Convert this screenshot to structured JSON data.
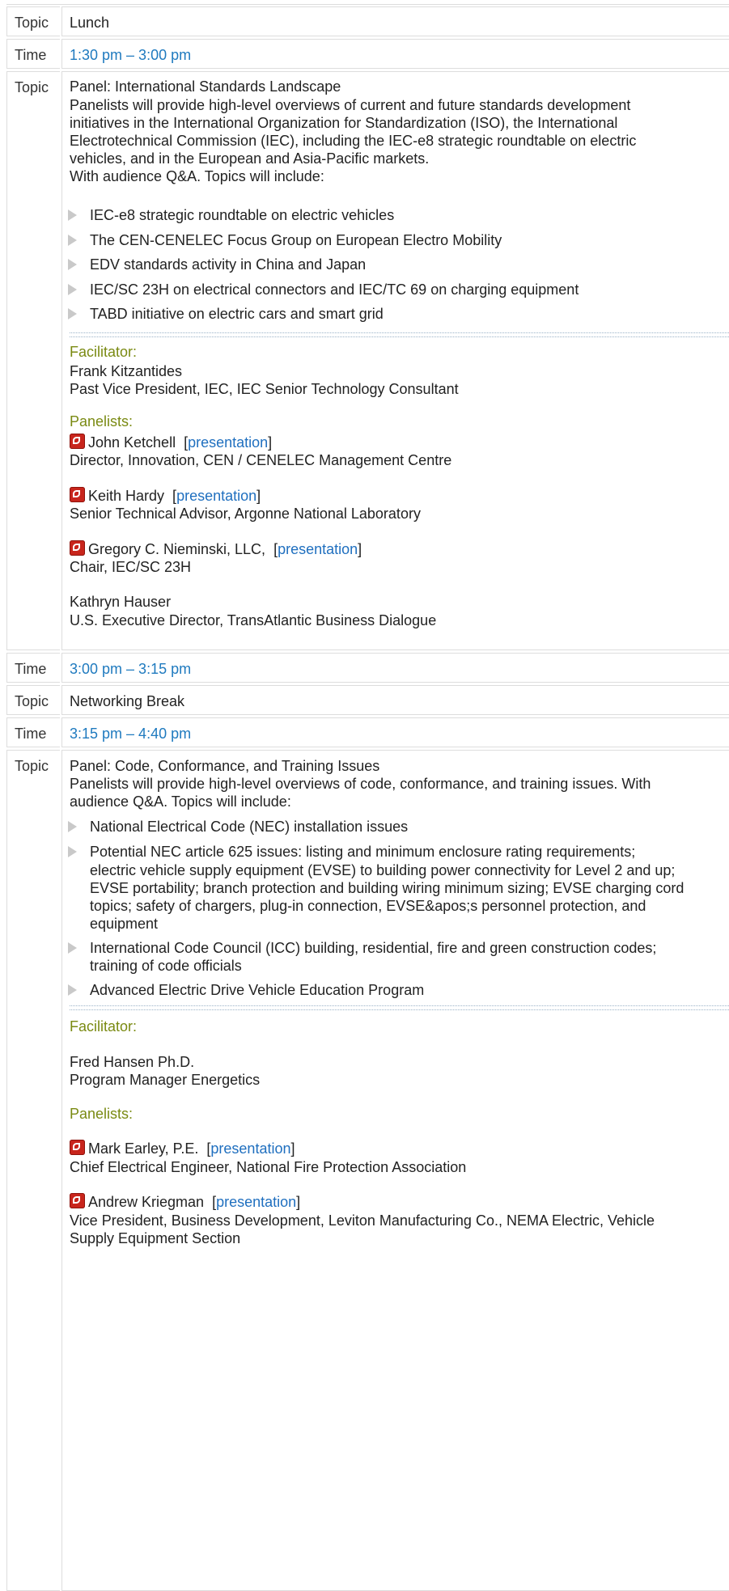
{
  "rows": {
    "lunch": {
      "label": "Topic",
      "text": "Lunch"
    },
    "time1": {
      "label": "Time",
      "text": "1:30 pm – 3:00 pm"
    },
    "panel1": {
      "label": "Topic"
    },
    "time2": {
      "label": "Time",
      "text": "3:00 pm – 3:15 pm"
    },
    "break": {
      "label": "Topic",
      "text": "Networking Break"
    },
    "time3": {
      "label": "Time",
      "text": "3:15 pm – 4:40 pm"
    },
    "panel2": {
      "label": "Topic"
    }
  },
  "panel1": {
    "title": "Panel: International Standards Landscape",
    "desc_lines": [
      "Panelists will provide high-level overviews of current and future standards development",
      "initiatives in the International Organization for Standardization (ISO), the International",
      "Electrotechnical Commission (IEC), including the IEC-e8 strategic roundtable on electric",
      "vehicles, and in the European and Asia-Pacific markets."
    ],
    "intro": "With audience Q&A. Topics will include:",
    "topics": [
      "IEC-e8 strategic roundtable on electric vehicles",
      "The CEN-CENELEC Focus Group on European Electro Mobility",
      "EDV standards activity in China and Japan",
      "IEC/SC 23H on electrical connectors and IEC/TC 69 on charging equipment",
      "TABD initiative on electric cars and smart grid"
    ],
    "facilitator_heading": "Facilitator:",
    "facilitator_name": "Frank Kitzantides",
    "facilitator_title": "Past Vice President, IEC, IEC Senior Technology Consultant",
    "panelists_heading": "Panelists:",
    "panelists": [
      {
        "name": "John Ketchell",
        "link": "presentation",
        "title": "Director, Innovation, CEN / CENELEC Management Centre"
      },
      {
        "name": "Keith Hardy",
        "link": "presentation",
        "title": "Senior Technical Advisor, Argonne National Laboratory"
      },
      {
        "name": "Gregory C. Nieminski, LLC,",
        "link": "presentation",
        "title": "Chair, IEC/SC 23H"
      },
      {
        "name": "Kathryn Hauser",
        "title": "U.S. Executive Director, TransAtlantic Business Dialogue"
      }
    ]
  },
  "panel2": {
    "title": "Panel: Code, Conformance, and Training Issues",
    "desc_lines": [
      "Panelists will provide high-level overviews of code, conformance, and training issues. With",
      "audience Q&A. Topics will include:"
    ],
    "topics": [
      {
        "lines": [
          "National Electrical Code (NEC) installation issues"
        ]
      },
      {
        "lines": [
          "Potential NEC article 625 issues: listing and minimum enclosure rating requirements;",
          "electric vehicle supply equipment (EVSE) to building power connectivity for Level 2 and up;",
          "EVSE portability; branch protection and building wiring minimum sizing; EVSE charging cord",
          "topics; safety of chargers, plug-in connection, EVSE&apos;s personnel protection, and",
          "equipment"
        ]
      },
      {
        "lines": [
          "International Code Council (ICC) building, residential, fire and green construction codes;",
          "training of code officials"
        ]
      },
      {
        "lines": [
          "Advanced Electric Drive Vehicle Education Program"
        ]
      }
    ],
    "facilitator_heading": "Facilitator:",
    "facilitator_name": "Fred Hansen Ph.D.",
    "facilitator_title": "Program Manager Energetics",
    "panelists_heading": "Panelists:",
    "panelists": [
      {
        "name": "Mark Earley, P.E.",
        "link": "presentation",
        "title_lines": [
          "Chief Electrical Engineer, National Fire Protection Association"
        ]
      },
      {
        "name": "Andrew Kriegman",
        "link": "presentation",
        "title_lines": [
          "Vice President, Business Development, Leviton Manufacturing Co., NEMA Electric, Vehicle",
          "Supply Equipment Section"
        ]
      }
    ]
  },
  "colors": {
    "time": "#1f7abf",
    "link": "#1f6fbf",
    "heading": "#7a8a12",
    "pdf_icon": "#c8251c",
    "border": "#dddddd"
  },
  "icons": {
    "pdf": "pdf-icon",
    "bullet": "triangle-bullet-icon"
  }
}
